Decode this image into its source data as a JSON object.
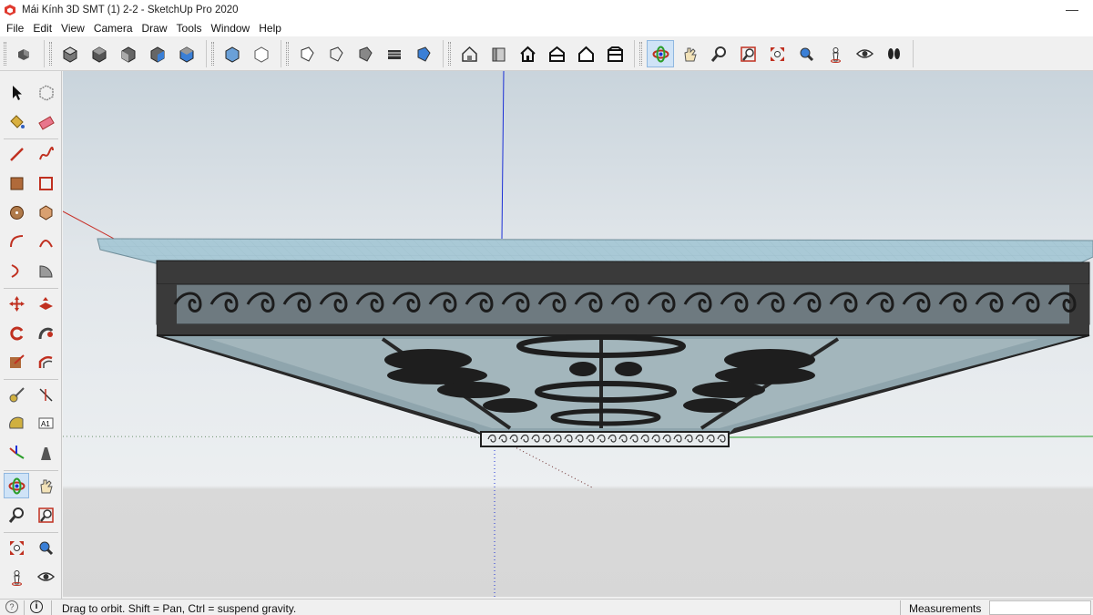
{
  "window": {
    "title": "Mái Kính 3D SMT (1) 2-2 - SketchUp Pro 2020",
    "minimize_glyph": "—"
  },
  "menu": [
    "File",
    "Edit",
    "View",
    "Camera",
    "Draw",
    "Tools",
    "Window",
    "Help"
  ],
  "toolbar": {
    "groups": [
      [
        "components-icon"
      ],
      [
        "iso-view-icon",
        "top-view-icon",
        "front-view-icon",
        "right-view-icon",
        "back-view-icon"
      ],
      [
        "xray-style-icon",
        "wireframe-style-icon"
      ],
      [
        "hidden-line-style-icon",
        "shaded-style-icon",
        "shaded-textures-style-icon",
        "monochrome-style-icon",
        "shaded-color-style-icon"
      ],
      [
        "warehouse-icon",
        "extension-warehouse-icon",
        "home-icon",
        "share-model-icon",
        "outline-house-icon",
        "warehouse-box-icon"
      ],
      [
        "orbit-icon",
        "pan-icon",
        "zoom-icon",
        "zoom-window-icon",
        "zoom-extents-icon",
        "previous-view-icon",
        "position-camera-icon",
        "look-around-icon",
        "walk-icon"
      ]
    ],
    "active": "orbit-icon"
  },
  "left_toolbar": {
    "rows": [
      [
        "select-icon",
        "make-component-icon"
      ],
      [
        "paint-bucket-icon",
        "eraser-icon"
      ],
      [
        "line-icon",
        "freehand-icon"
      ],
      [
        "rectangle-icon",
        "rotated-rectangle-icon"
      ],
      [
        "circle-icon",
        "polygon-icon"
      ],
      [
        "arc-icon",
        "two-point-arc-icon"
      ],
      [
        "three-point-arc-icon",
        "pie-icon"
      ],
      [
        "move-icon",
        "push-pull-icon"
      ],
      [
        "rotate-icon",
        "follow-me-icon"
      ],
      [
        "scale-icon",
        "offset-icon"
      ],
      [
        "tape-measure-icon",
        "dimension-icon"
      ],
      [
        "protractor-icon",
        "text-icon"
      ],
      [
        "axes-icon",
        "3d-text-icon"
      ],
      [
        "orbit-icon",
        "pan-icon"
      ],
      [
        "zoom-icon",
        "zoom-window-icon"
      ],
      [
        "zoom-extents-icon",
        "previous-view-icon"
      ],
      [
        "position-camera-icon",
        "look-around-icon"
      ]
    ],
    "text_icon_label": "A1"
  },
  "status": {
    "message": "Drag to orbit. Shift = Pan, Ctrl = suspend gravity.",
    "measurements_label": "Measurements",
    "measurements_value": ""
  },
  "colors": {
    "axis_blue": "#1b2fd6",
    "axis_red": "#c8322a",
    "axis_green": "#2a9d2a",
    "glass": "#a9c9d6",
    "frame": "#3a3a3a",
    "active_tool": "#cfe3f7"
  }
}
